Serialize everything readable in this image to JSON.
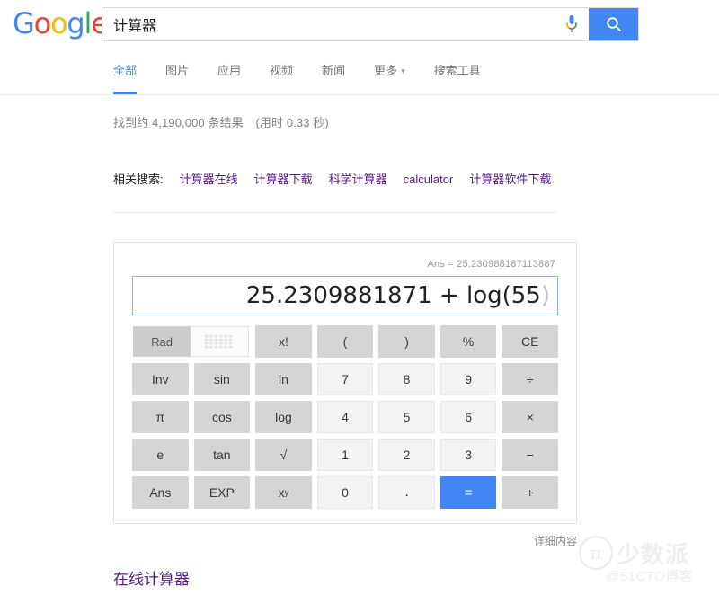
{
  "brand": {
    "name": "Google",
    "letters": [
      {
        "ch": "G",
        "color": "#4285f4"
      },
      {
        "ch": "o",
        "color": "#ea4335"
      },
      {
        "ch": "o",
        "color": "#fbbc05"
      },
      {
        "ch": "g",
        "color": "#4285f4"
      },
      {
        "ch": "l",
        "color": "#34a853"
      },
      {
        "ch": "e",
        "color": "#ea4335"
      }
    ]
  },
  "search": {
    "value": "计算器",
    "placeholder": "",
    "mic_icon": "microphone-icon",
    "search_icon": "search-icon"
  },
  "nav": {
    "items": [
      {
        "label": "全部",
        "active": true
      },
      {
        "label": "图片",
        "active": false
      },
      {
        "label": "应用",
        "active": false
      },
      {
        "label": "视频",
        "active": false
      },
      {
        "label": "新闻",
        "active": false
      },
      {
        "label": "更多",
        "active": false,
        "caret": "▾"
      },
      {
        "label": "搜索工具",
        "active": false
      }
    ]
  },
  "results": {
    "stats": "找到约 4,190,000 条结果",
    "time": "(用时 0.33 秒)"
  },
  "related": {
    "label": "相关搜索:",
    "links": [
      "计算器在线",
      "计算器下载",
      "科学计算器",
      "calculator",
      "计算器软件下载"
    ]
  },
  "calculator": {
    "ans_line": "Ans = 25.230988187113887",
    "expression": "25.2309881871 + log(55",
    "expression_ghost": ")",
    "mode_label": "Rad",
    "keypad_icon": "keypad-grid-icon",
    "keys": [
      {
        "label": "x!",
        "type": "fn",
        "name": "factorial"
      },
      {
        "label": "(",
        "type": "fn",
        "name": "open-paren"
      },
      {
        "label": ")",
        "type": "fn",
        "name": "close-paren"
      },
      {
        "label": "%",
        "type": "fn",
        "name": "percent"
      },
      {
        "label": "CE",
        "type": "fn",
        "name": "clear-entry"
      },
      {
        "label": "Inv",
        "type": "fn",
        "name": "inverse"
      },
      {
        "label": "sin",
        "type": "fn",
        "name": "sin"
      },
      {
        "label": "ln",
        "type": "fn",
        "name": "ln"
      },
      {
        "label": "7",
        "type": "num",
        "name": "digit-7"
      },
      {
        "label": "8",
        "type": "num",
        "name": "digit-8"
      },
      {
        "label": "9",
        "type": "num",
        "name": "digit-9"
      },
      {
        "label": "÷",
        "type": "fn",
        "name": "divide"
      },
      {
        "label": "π",
        "type": "fn",
        "name": "pi"
      },
      {
        "label": "cos",
        "type": "fn",
        "name": "cos"
      },
      {
        "label": "log",
        "type": "fn",
        "name": "log"
      },
      {
        "label": "4",
        "type": "num",
        "name": "digit-4"
      },
      {
        "label": "5",
        "type": "num",
        "name": "digit-5"
      },
      {
        "label": "6",
        "type": "num",
        "name": "digit-6"
      },
      {
        "label": "×",
        "type": "fn",
        "name": "multiply"
      },
      {
        "label": "e",
        "type": "fn",
        "name": "euler"
      },
      {
        "label": "tan",
        "type": "fn",
        "name": "tan"
      },
      {
        "label": "√",
        "type": "fn",
        "name": "square-root"
      },
      {
        "label": "1",
        "type": "num",
        "name": "digit-1"
      },
      {
        "label": "2",
        "type": "num",
        "name": "digit-2"
      },
      {
        "label": "3",
        "type": "num",
        "name": "digit-3"
      },
      {
        "label": "−",
        "type": "fn",
        "name": "subtract"
      },
      {
        "label": "Ans",
        "type": "fn",
        "name": "answer"
      },
      {
        "label": "EXP",
        "type": "fn",
        "name": "exponent"
      },
      {
        "label": "xy",
        "type": "pow",
        "name": "power"
      },
      {
        "label": "0",
        "type": "num",
        "name": "digit-0"
      },
      {
        "label": ".",
        "type": "num-dot",
        "name": "decimal-point"
      },
      {
        "label": "=",
        "type": "equals",
        "name": "equals"
      },
      {
        "label": "+",
        "type": "fn",
        "name": "add"
      }
    ],
    "footer_link": "详细内容"
  },
  "bottom_result": {
    "title": "在线计算器"
  },
  "watermark": {
    "symbol": "π",
    "main": "少数派",
    "sub": "@51CTO博客"
  },
  "colors": {
    "google_blue": "#4285f4",
    "google_red": "#ea4335",
    "google_yellow": "#fbbc05",
    "google_green": "#34a853",
    "link_visited": "#551a8b",
    "key_fn": "#d5d5d5",
    "key_num": "#f3f3f3"
  }
}
